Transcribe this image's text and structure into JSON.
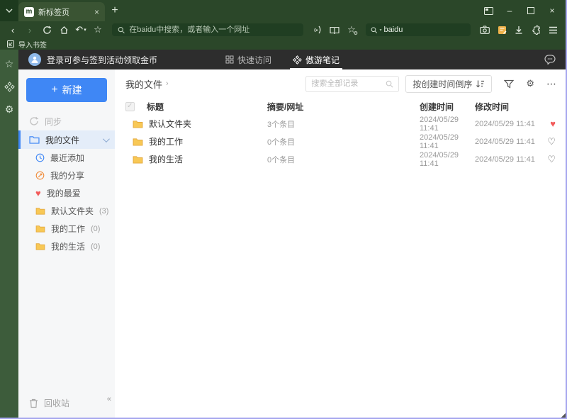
{
  "browser": {
    "tab_title": "新标签页",
    "address_placeholder": "在baidu中搜索，或者输入一个网址",
    "search_value": "baidu",
    "import_bookmarks_label": "导入书签"
  },
  "app": {
    "header": {
      "login_text": "登录可参与签到活动领取金币",
      "tab_quick_access": "快速访问",
      "tab_notes": "傲游笔记"
    },
    "sidebar": {
      "new_label": "新建",
      "sync_label": "同步",
      "my_files_label": "我的文件",
      "recent_label": "最近添加",
      "shares_label": "我的分享",
      "favorites_label": "我的最爱",
      "folders": [
        {
          "name": "默认文件夹",
          "count": "(3)"
        },
        {
          "name": "我的工作",
          "count": "(0)"
        },
        {
          "name": "我的生活",
          "count": "(0)"
        }
      ],
      "trash_label": "回收站",
      "collapse_glyph": "«"
    },
    "main": {
      "breadcrumb": "我的文件",
      "breadcrumb_arrow": "›",
      "search_placeholder": "搜索全部记录",
      "sort_label": "按创建时间倒序",
      "more_glyph": "⋯",
      "table": {
        "headers": {
          "title": "标题",
          "summary": "摘要/网址",
          "created": "创建时间",
          "modified": "修改时间"
        },
        "rows": [
          {
            "title": "默认文件夹",
            "summary": "3个条目",
            "created": "2024/05/29 11:41",
            "modified": "2024/05/29 11:41",
            "favorite": true
          },
          {
            "title": "我的工作",
            "summary": "0个条目",
            "created": "2024/05/29 11:41",
            "modified": "2024/05/29 11:41",
            "favorite": false
          },
          {
            "title": "我的生活",
            "summary": "0个条目",
            "created": "2024/05/29 11:41",
            "modified": "2024/05/29 11:41",
            "favorite": false
          }
        ]
      }
    }
  },
  "colors": {
    "chrome_green": "#2b4729",
    "accent_blue": "#3f87f5",
    "favorite_red": "#f25b5b",
    "folder_yellow": "#f8c855",
    "window_border": "#a6a6ee"
  }
}
